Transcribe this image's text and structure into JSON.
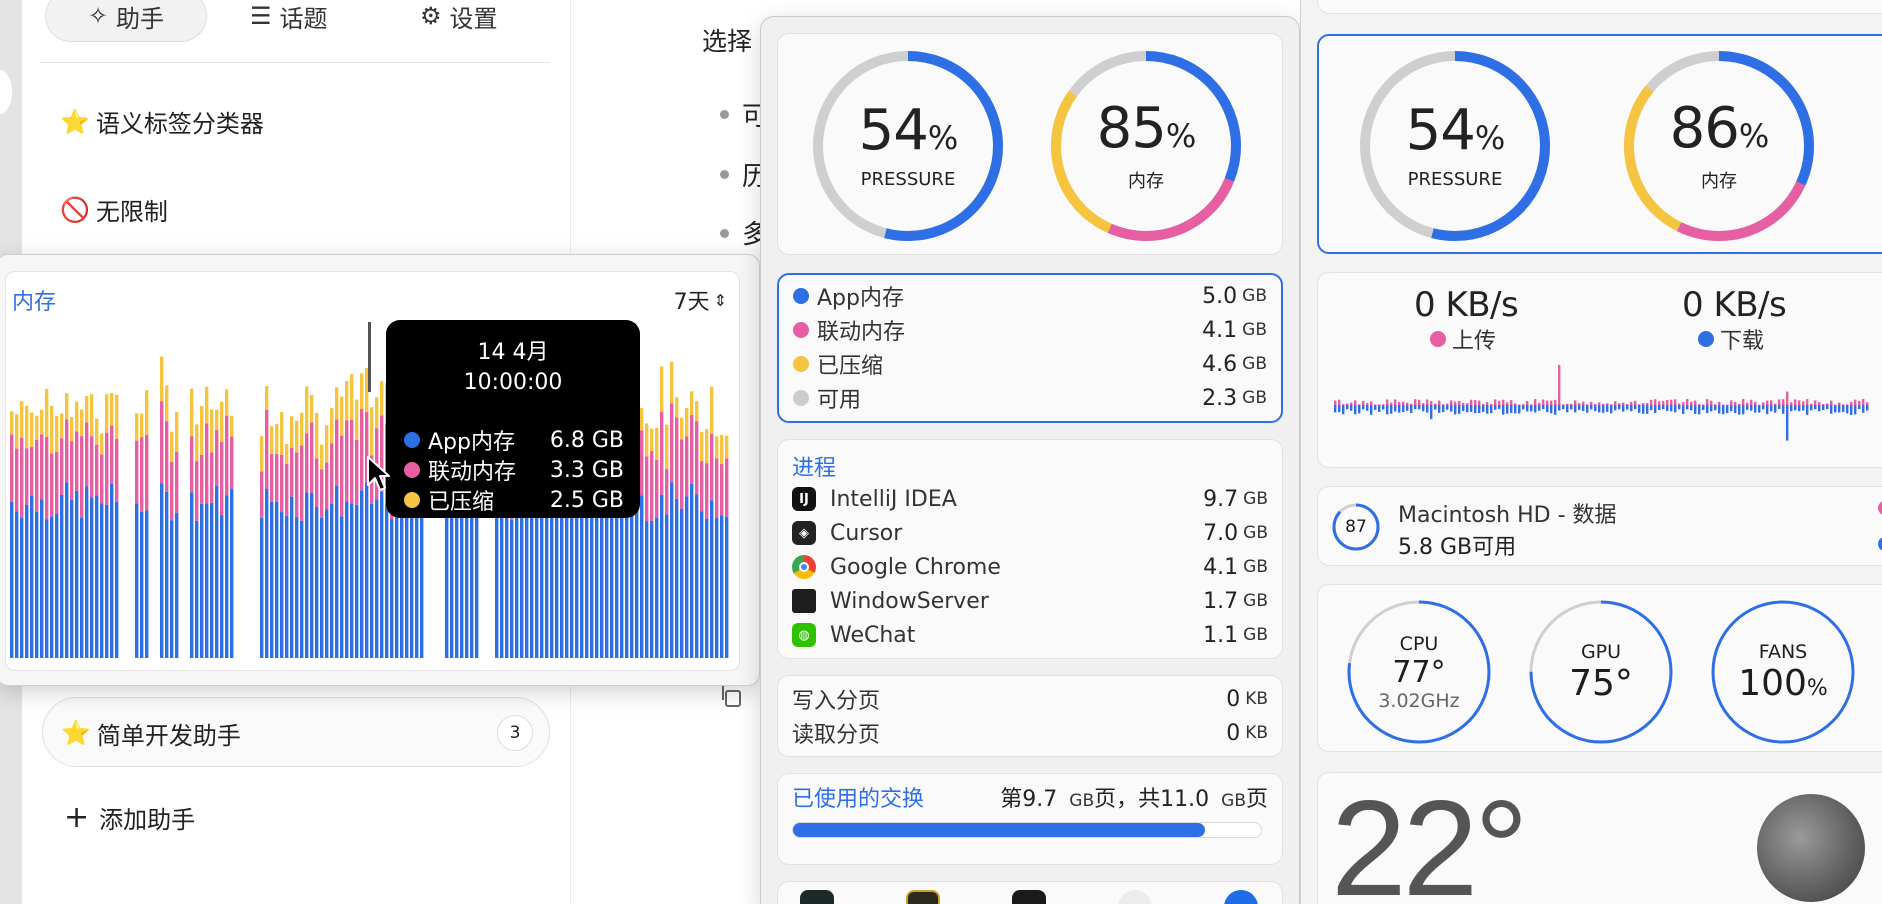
{
  "left_app": {
    "tabs": [
      {
        "label": "助手",
        "icon": "sparkle-icon"
      },
      {
        "label": "话题",
        "icon": "list-icon"
      },
      {
        "label": "设置",
        "icon": "gear-icon"
      }
    ],
    "assistants": [
      {
        "emoji": "⭐",
        "label": "语义标签分类器"
      },
      {
        "emoji": "🚫",
        "label": "无限制"
      }
    ],
    "active_assistant": {
      "emoji": "⭐",
      "label": "简单开发助手",
      "count": "3"
    },
    "add_label": "添加助手"
  },
  "center_text": {
    "heading": "选择",
    "bullets": [
      "可",
      "历",
      "多"
    ]
  },
  "memory_history": {
    "title": "内存",
    "range": "7天",
    "tooltip": {
      "date": "14 4月",
      "time": "10:00:00",
      "rows": [
        {
          "label": "App内存",
          "value": "6.8 GB",
          "color": "#2f6fe6"
        },
        {
          "label": "联动内存",
          "value": "3.3 GB",
          "color": "#e65fa3"
        },
        {
          "label": "已压缩",
          "value": "2.5 GB",
          "color": "#f5c542"
        }
      ]
    }
  },
  "memory_panel": {
    "gauges": [
      {
        "value": "54",
        "unit": "%",
        "label": "PRESSURE"
      },
      {
        "value": "85",
        "unit": "%",
        "label": "内存"
      }
    ],
    "breakdown": [
      {
        "label": "App内存",
        "value": "5.0",
        "unit": "GB",
        "color": "#2f6fe6"
      },
      {
        "label": "联动内存",
        "value": "4.1",
        "unit": "GB",
        "color": "#e65fa3"
      },
      {
        "label": "已压缩",
        "value": "4.6",
        "unit": "GB",
        "color": "#f5c542"
      },
      {
        "label": "可用",
        "value": "2.3",
        "unit": "GB",
        "color": "#cccccc"
      }
    ],
    "process_title": "进程",
    "processes": [
      {
        "label": "IntelliJ IDEA",
        "value": "9.7",
        "unit": "GB",
        "icon": "intellij-icon"
      },
      {
        "label": "Cursor",
        "value": "7.0",
        "unit": "GB",
        "icon": "cursor-app-icon"
      },
      {
        "label": "Google Chrome",
        "value": "4.1",
        "unit": "GB",
        "icon": "chrome-icon"
      },
      {
        "label": "WindowServer",
        "value": "1.7",
        "unit": "GB",
        "icon": "windowserver-icon"
      },
      {
        "label": "WeChat",
        "value": "1.1",
        "unit": "GB",
        "icon": "wechat-icon"
      }
    ],
    "paging": [
      {
        "label": "写入分页",
        "value": "0",
        "unit": "KB"
      },
      {
        "label": "读取分页",
        "value": "0",
        "unit": "KB"
      }
    ],
    "swap": {
      "title": "已使用的交换",
      "pre": "第",
      "used": "9.7",
      "used_unit": "GB",
      "mid": "页，共",
      "total": "11.0",
      "total_unit": "GB",
      "post": "页",
      "fraction": 0.88
    }
  },
  "right_panel": {
    "gauges": [
      {
        "value": "54",
        "unit": "%",
        "label": "PRESSURE"
      },
      {
        "value": "86",
        "unit": "%",
        "label": "内存"
      }
    ],
    "network": {
      "upload": {
        "value": "0 KB/s",
        "label": "上传",
        "color": "#e65fa3"
      },
      "download": {
        "value": "0 KB/s",
        "label": "下载",
        "color": "#2f6fe6"
      }
    },
    "disk": {
      "percent": "87",
      "name": "Macintosh HD - 数据",
      "free": "5.8 GB可用"
    },
    "sensors": [
      {
        "label": "CPU",
        "value": "77°",
        "sub": "3.02GHz"
      },
      {
        "label": "GPU",
        "value": "75°",
        "sub": ""
      },
      {
        "label": "FANS",
        "value": "100",
        "unit": "%",
        "sub": ""
      }
    ],
    "weather": {
      "temperature": "22°"
    }
  },
  "colors": {
    "accent": "#2f6fe6",
    "pink": "#e65fa3",
    "yellow": "#f5c542",
    "gray_ring": "#cccccc"
  }
}
